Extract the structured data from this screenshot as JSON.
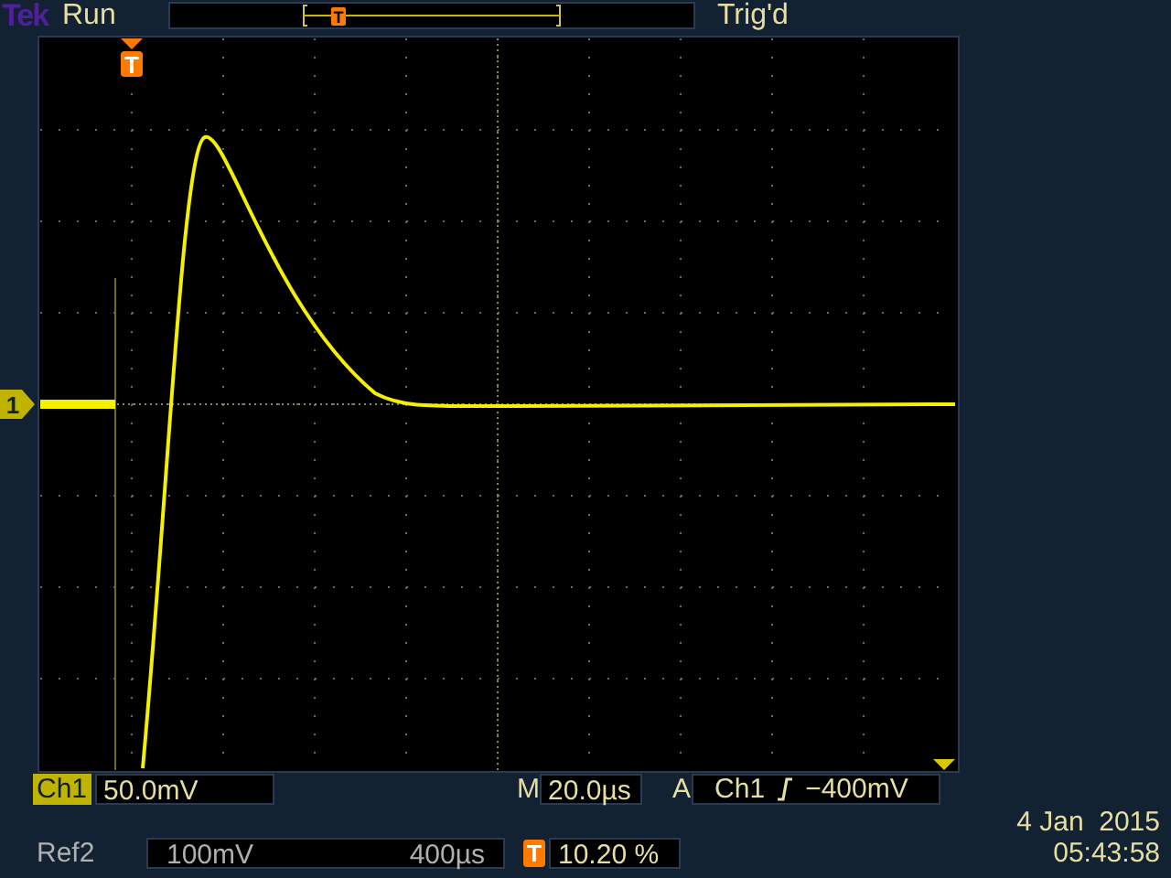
{
  "header": {
    "logo": "Tek",
    "status": "Run",
    "trigger_marker": "T",
    "trigger_status": "Trig'd"
  },
  "graticule": {
    "trigger_marker": "T",
    "channel_marker": "1"
  },
  "readouts": {
    "channel": "Ch1",
    "scale": "50.0mV",
    "timebase_label": "M",
    "timebase": "20.0µs",
    "trigger_label": "A",
    "trigger_source": "Ch1",
    "trigger_level": "−400mV"
  },
  "reference": {
    "name": "Ref2",
    "scale": "100mV",
    "timebase": "400µs"
  },
  "trigger_position": {
    "marker": "T",
    "value": "10.20 %"
  },
  "date": "4 Jan  2015",
  "time": "05:43:58"
}
